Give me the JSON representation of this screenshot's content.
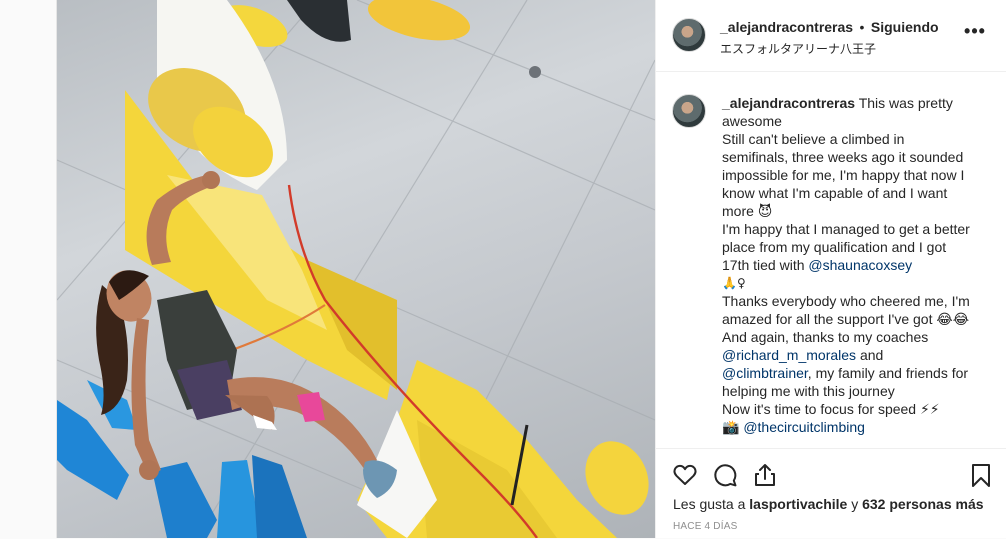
{
  "post": {
    "username": "_alejandracontreras",
    "separator": "•",
    "follow_status": "Siguiendo",
    "location": "エスフォルタアリーナ八王子",
    "more_label": "•••"
  },
  "caption": {
    "username": "_alejandracontreras",
    "lines": [
      "This was pretty awesome",
      "Still can't believe a climbed in semifinals, three weeks ago it sounded impossible for me, I'm happy that now I know what I'm capable of and I want more 😈",
      "I'm happy that I managed to get a better place from my qualification and I got 17th tied with",
      "🙏♀",
      "Thanks everybody who cheered me, I'm amazed for all the support I've got 😂😂",
      "And again, thanks to my coaches",
      "and",
      ", my family and friends for helping me with this journey",
      "Now it's time to focus for speed ⚡⚡",
      "📸"
    ],
    "mentions": {
      "shauna": "@shaunacoxsey",
      "richard": "@richard_m_morales",
      "climbtrainer": "@climbtrainer",
      "circuit": "@thecircuitclimbing"
    }
  },
  "actions": {
    "like_icon": "heart-icon",
    "comment_icon": "comment-icon",
    "share_icon": "share-icon",
    "save_icon": "bookmark-icon"
  },
  "likes": {
    "prefix": "Les gusta a",
    "user": "lasportivachile",
    "middle": "y",
    "count": "632 personas más"
  },
  "timestamp": "HACE 4 DÍAS",
  "colors": {
    "mention": "#003569",
    "text": "#262626",
    "muted": "#8e8e8e",
    "hold_yellow": "#f2d43a",
    "hold_blue": "#1e88d6"
  }
}
